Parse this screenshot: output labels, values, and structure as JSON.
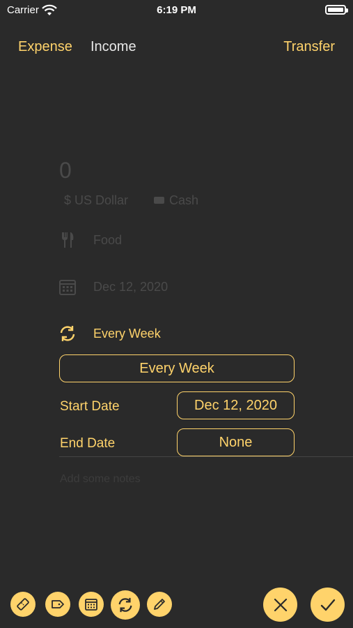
{
  "status": {
    "carrier": "Carrier",
    "time": "6:19 PM"
  },
  "tabs": {
    "expense": "Expense",
    "income": "Income",
    "transfer": "Transfer"
  },
  "amount": "0",
  "currency": "$ US Dollar",
  "account": "Cash",
  "category": "Food",
  "date": "Dec 12, 2020",
  "repeat": {
    "label": "Every Week",
    "frequency_button": "Every Week",
    "start_label": "Start Date",
    "start_value": "Dec 12, 2020",
    "end_label": "End Date",
    "end_value": "None"
  },
  "notes_placeholder": "Add some notes",
  "colors": {
    "accent": "#ffd36b",
    "background": "#2a2a2a"
  },
  "toolbar_icons": [
    "ticket-icon",
    "tag-icon",
    "calendar-icon",
    "repeat-icon",
    "pencil-icon"
  ],
  "actions": {
    "cancel_icon": "close-icon",
    "confirm_icon": "checkmark-icon"
  }
}
